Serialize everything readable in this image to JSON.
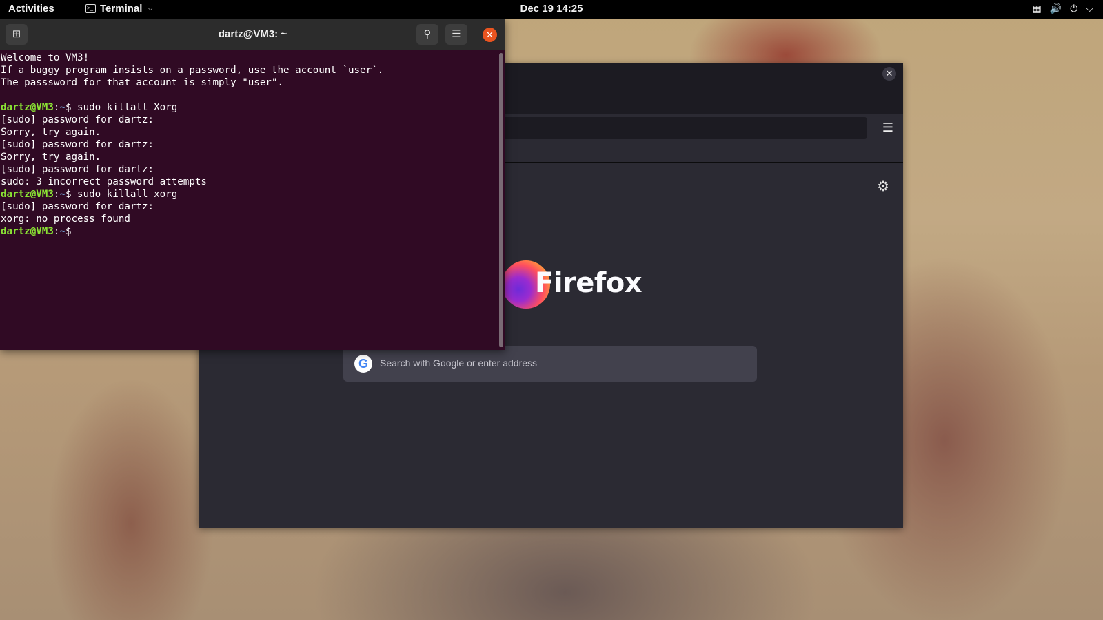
{
  "topbar": {
    "activities": "Activities",
    "app_name": "Terminal",
    "clock": "Dec 19  14:25",
    "tray_icons": [
      "network-icon",
      "volume-icon",
      "power-icon",
      "chevron-down-icon"
    ]
  },
  "terminal": {
    "title": "dartz@VM3: ~",
    "lines": [
      {
        "text": "Welcome to VM3!"
      },
      {
        "text": "If a buggy program insists on a password, use the account `user`."
      },
      {
        "text": "The passsword for that account is simply \"user\"."
      },
      {
        "text": ""
      },
      {
        "user": "dartz@VM3",
        "sep": ":",
        "path": "~",
        "text": "$ sudo killall Xorg"
      },
      {
        "text": "[sudo] password for dartz:"
      },
      {
        "text": "Sorry, try again."
      },
      {
        "text": "[sudo] password for dartz:"
      },
      {
        "text": "Sorry, try again."
      },
      {
        "text": "[sudo] password for dartz:"
      },
      {
        "text": "sudo: 3 incorrect password attempts"
      },
      {
        "user": "dartz@VM3",
        "sep": ":",
        "path": "~",
        "text": "$ sudo killall xorg"
      },
      {
        "text": "[sudo] password for dartz:"
      },
      {
        "text": "xorg: no process found"
      },
      {
        "user": "dartz@VM3",
        "sep": ":",
        "path": "~",
        "text": "$ "
      }
    ]
  },
  "firefox": {
    "wordmark": "Firefox",
    "search_placeholder": "Search with Google or enter address",
    "google_glyph": "G"
  },
  "colors": {
    "terminal_bg": "#300a24",
    "prompt_user": "#8ae234",
    "prompt_path": "#729fcf",
    "close_accent": "#e95420",
    "firefox_bg": "#2b2a33"
  }
}
